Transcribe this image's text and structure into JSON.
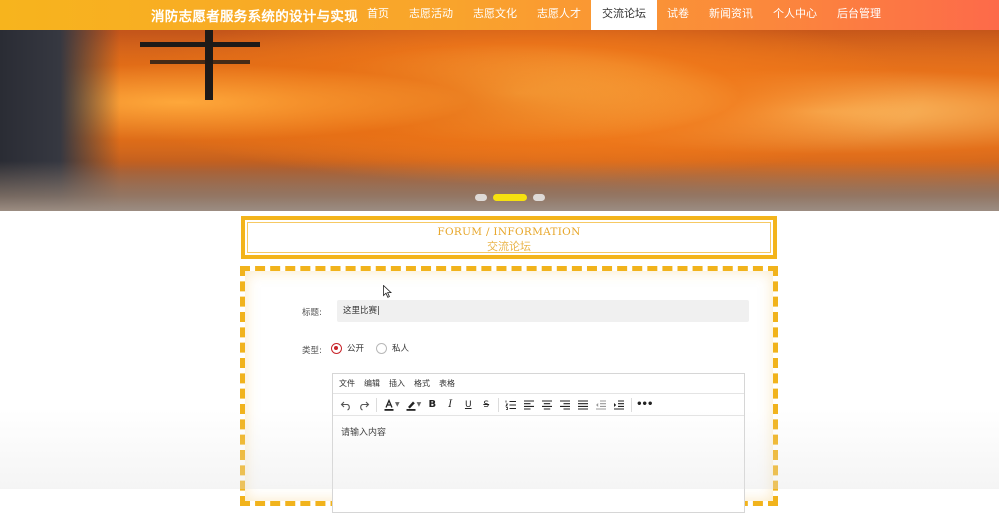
{
  "header": {
    "site_title": "消防志愿者服务系统的设计与实现",
    "menu": [
      {
        "label": "首页",
        "active": false
      },
      {
        "label": "志愿活动",
        "active": false
      },
      {
        "label": "志愿文化",
        "active": false
      },
      {
        "label": "志愿人才",
        "active": false
      },
      {
        "label": "交流论坛",
        "active": true
      },
      {
        "label": "试卷",
        "active": false
      },
      {
        "label": "新闻资讯",
        "active": false
      },
      {
        "label": "个人中心",
        "active": false
      },
      {
        "label": "后台管理",
        "active": false
      }
    ]
  },
  "carousel": {
    "slides": 3,
    "active_index": 1
  },
  "section": {
    "title_en": "FORUM / INFORMATION",
    "title_cn": "交流论坛"
  },
  "form": {
    "title_label": "标题:",
    "title_value": "这里比赛|",
    "type_label": "类型:",
    "type_options": [
      {
        "label": "公开",
        "checked": true
      },
      {
        "label": "私人",
        "checked": false
      }
    ],
    "editor": {
      "menubar": [
        "文件",
        "编辑",
        "插入",
        "格式",
        "表格"
      ],
      "toolbar": [
        "undo-icon",
        "redo-icon",
        "font-color-icon",
        "highlight-icon",
        "bold-icon",
        "italic-icon",
        "underline-icon",
        "strikethrough-icon",
        "numbered-list-icon",
        "align-left-icon",
        "align-center-icon",
        "align-right-icon",
        "align-justify-icon",
        "outdent-icon",
        "indent-icon",
        "more-icon"
      ],
      "placeholder": "请输入内容"
    }
  },
  "colors": {
    "nav_gradient_start": "#f7b41d",
    "nav_gradient_end": "#fd6a4a",
    "accent_border": "#f3b41b",
    "radio_checked": "#c8242a",
    "carousel_active_dot": "#f6e10f"
  }
}
